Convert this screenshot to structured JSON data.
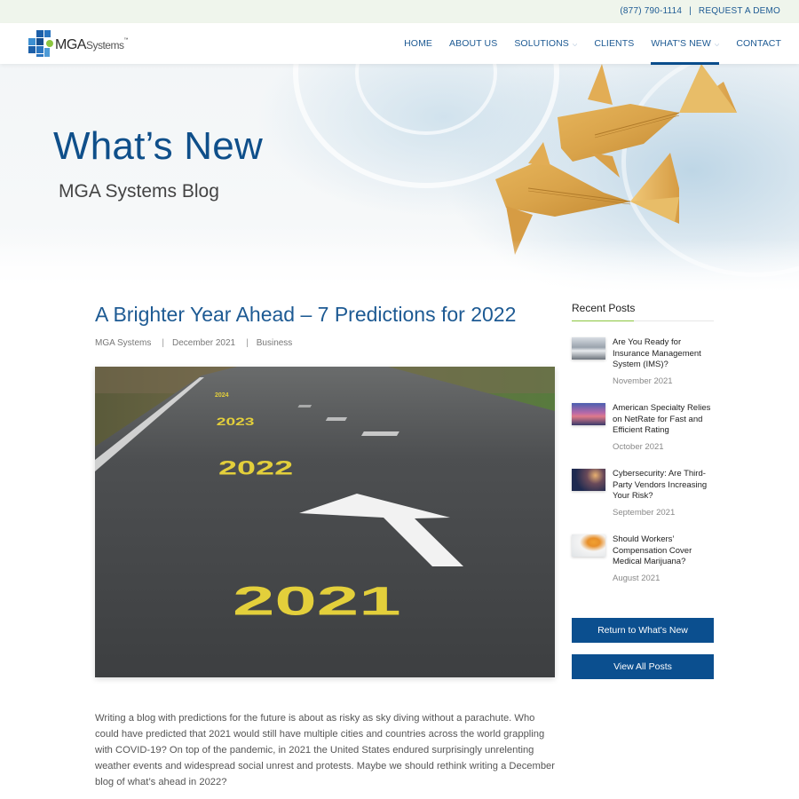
{
  "utility": {
    "phone": "(877) 790-1114",
    "separator": "|",
    "demo": "REQUEST A DEMO"
  },
  "brand": {
    "name_bold": "MGA",
    "name_light": "Systems",
    "tm": "™",
    "accent_blue": "#0b4f8f",
    "accent_green": "#8cc63f"
  },
  "nav": {
    "items": [
      {
        "label": "HOME",
        "dropdown": false,
        "active": false
      },
      {
        "label": "ABOUT US",
        "dropdown": false,
        "active": false
      },
      {
        "label": "SOLUTIONS",
        "dropdown": true,
        "active": false
      },
      {
        "label": "CLIENTS",
        "dropdown": false,
        "active": false
      },
      {
        "label": "WHAT'S NEW",
        "dropdown": true,
        "active": true
      },
      {
        "label": "CONTACT",
        "dropdown": false,
        "active": false
      }
    ],
    "chevron": "⌵"
  },
  "hero": {
    "title": "What’s New",
    "subtitle": "MGA Systems Blog",
    "image_alt": "origami-koi-fish"
  },
  "post": {
    "title": "A Brighter Year Ahead – 7 Predictions for 2022",
    "author": "MGA Systems",
    "date": "December 2021",
    "category": "Business",
    "meta_separator": "|",
    "image": {
      "road_years": [
        "2024",
        "2023",
        "2022",
        "2021"
      ]
    },
    "body": "Writing a blog with predictions for the future is about as risky as sky diving without a parachute. Who could have predicted that 2021 would still have multiple cities and countries across the world grappling with COVID-19? On top of the pandemic, in 2021 the United States endured surprisingly unrelenting weather events and widespread social unrest and protests. Maybe we should rethink writing a December blog of what’s ahead in 2022?"
  },
  "sidebar": {
    "title": "Recent Posts",
    "posts": [
      {
        "title": "Are You Ready for Insurance Management System (IMS)?",
        "date": "November 2021"
      },
      {
        "title": "American Specialty Relies on NetRate for Fast and Efficient Rating",
        "date": "October 2021"
      },
      {
        "title": "Cybersecurity: Are Third-Party Vendors Increasing Your Risk?",
        "date": "September 2021"
      },
      {
        "title": "Should Workers’ Compensation Cover Medical Marijuana?",
        "date": "August 2021"
      }
    ],
    "buttons": {
      "return": "Return to What's New",
      "view_all": "View All Posts"
    }
  }
}
